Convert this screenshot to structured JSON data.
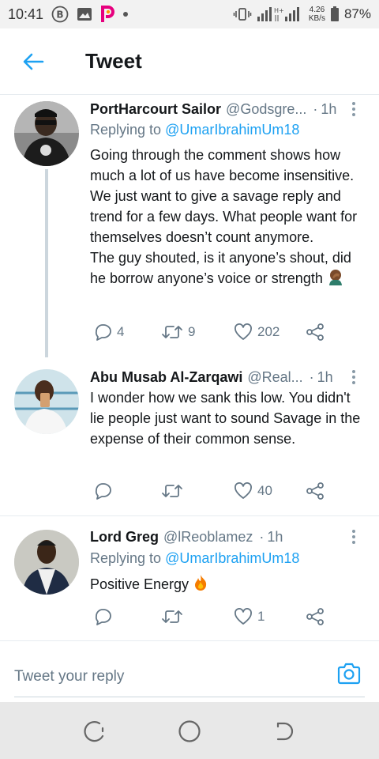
{
  "status_bar": {
    "time": "10:41",
    "net_speed_value": "4.26",
    "net_speed_unit": "KB/s",
    "battery": "87%",
    "network_label": "H+",
    "icons": [
      "b-circle-icon",
      "gallery-icon",
      "picsart-icon",
      "dot-icon",
      "vibrate-icon",
      "signal-icon",
      "battery-icon"
    ]
  },
  "header": {
    "title": "Tweet",
    "accent_color": "#1da1f2"
  },
  "tweets": [
    {
      "name": "PortHarcourt Sailor",
      "handle": "@Godsgre...",
      "time": "1h",
      "replying_label": "Replying to",
      "replying_to": "@UmarIbrahimUm18",
      "text": "Going through the comment shows how much a lot of us have become insensitive. We just want to give a savage reply and trend for a few days. What people want for themselves doesn’t count anymore.\nThe guy shouted, is it anyone’s shout, did he borrow anyone’s voice or strength ",
      "emoji": "facepalm-emoji",
      "replies": "4",
      "retweets": "9",
      "likes": "202"
    },
    {
      "name": "Abu Musab Al-Zarqawi",
      "handle": "@Real...",
      "time": "1h",
      "text": "I wonder how we sank this low. You didn't lie people just want to sound Savage in the expense of their common sense.",
      "replies": "",
      "retweets": "",
      "likes": "40"
    },
    {
      "name": "Lord Greg",
      "handle": "@lReoblamez",
      "time": "1h",
      "replying_label": "Replying to",
      "replying_to": "@UmarIbrahimUm18",
      "text": "Positive Energy ",
      "emoji": "fire-emoji",
      "replies": "",
      "retweets": "",
      "likes": "1"
    }
  ],
  "composer": {
    "placeholder": "Tweet your reply"
  },
  "navbar": {
    "icons": [
      "recent-apps-icon",
      "home-icon",
      "back-icon"
    ]
  }
}
